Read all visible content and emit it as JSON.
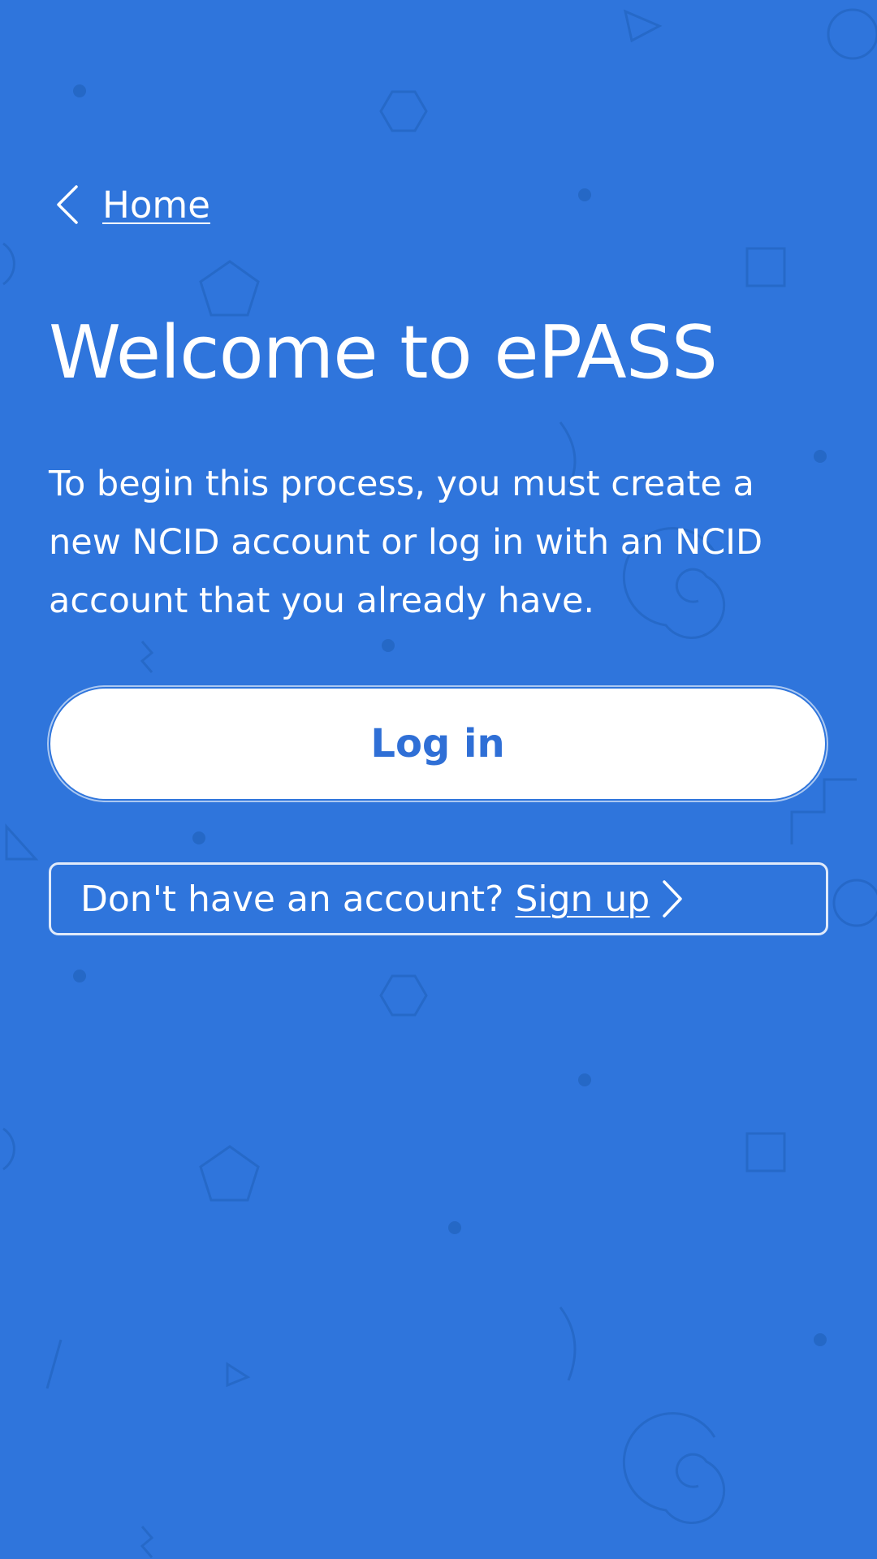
{
  "nav": {
    "back_label": "Home",
    "back_icon": "chevron-left-icon"
  },
  "main": {
    "title": "Welcome to ePASS",
    "intro": "To begin this process, you must create a new NCID account or log in with an NCID account that you already have.",
    "login_label": "Log in",
    "signup_prompt": "Don't have an account? ",
    "signup_label": "Sign up",
    "signup_icon": "chevron-right-icon"
  },
  "colors": {
    "background": "#2f75dc",
    "button_text": "#2f6fd6",
    "text": "#ffffff"
  }
}
